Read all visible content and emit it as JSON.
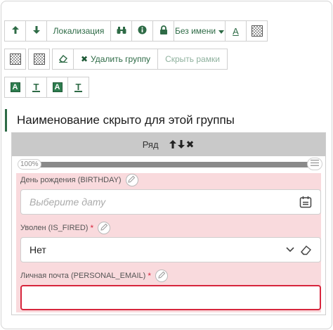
{
  "toolbar": {
    "row1": {
      "move_up_icon": "arrow-up-icon",
      "move_down_icon": "arrow-down-icon",
      "localization_label": "Локализация",
      "binoculars_icon": "binoculars-icon",
      "info_icon": "info-icon",
      "lock_icon": "lock-icon",
      "name_dropdown_label": "Без имени",
      "text_color_icon_letter": "A"
    },
    "row2": {
      "eraser_icon": "eraser-icon",
      "delete_group_label": "Удалить группу",
      "hide_borders_label": "Скрыть рамки"
    },
    "row3": {
      "letter_a": "A",
      "letter_t": "T"
    }
  },
  "group": {
    "title": "Наименование скрыто для этой группы",
    "row_label": "Ряд",
    "slider_value": "100%",
    "slider_percent": 100
  },
  "fields": [
    {
      "label": "День рождения (BIRTHDAY)",
      "required": false,
      "placeholder": "Выберите дату",
      "value": ""
    },
    {
      "label": "Уволен (IS_FIRED)",
      "required": true,
      "required_mark": "*",
      "value": "Нет"
    },
    {
      "label": "Личная почта (PERSONAL_EMAIL)",
      "required": true,
      "required_mark": "*",
      "value": "",
      "state": "error"
    }
  ],
  "colors": {
    "accent_green": "#2e6b46",
    "error_red": "#d7263d",
    "row_header_grey": "#c9c9c9",
    "field_area_pink": "#f9dadd"
  }
}
